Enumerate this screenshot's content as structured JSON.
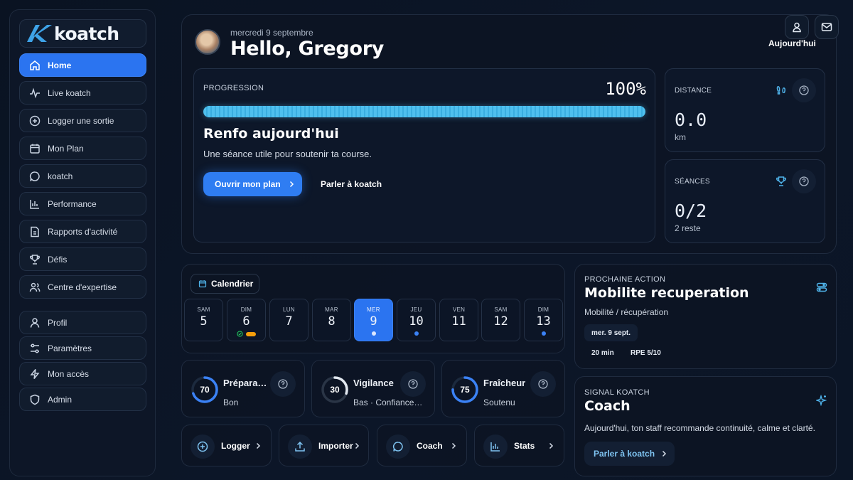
{
  "brand": {
    "name": "koatch"
  },
  "sidebar": {
    "items": [
      {
        "label": "Home",
        "icon": "home-icon"
      },
      {
        "label": "Live koatch",
        "icon": "activity-icon"
      },
      {
        "label": "Logger une sortie",
        "icon": "plus-circle-icon"
      },
      {
        "label": "Mon Plan",
        "icon": "calendar-icon"
      },
      {
        "label": "koatch",
        "icon": "chat-icon"
      },
      {
        "label": "Performance",
        "icon": "bar-chart-icon"
      },
      {
        "label": "Rapports d'activité",
        "icon": "document-icon"
      },
      {
        "label": "Défis",
        "icon": "trophy-icon"
      },
      {
        "label": "Centre d'expertise",
        "icon": "users-icon"
      }
    ],
    "bottom_items": [
      {
        "label": "Profil",
        "icon": "user-icon"
      },
      {
        "label": "Paramètres",
        "icon": "sliders-icon"
      },
      {
        "label": "Mon accès",
        "icon": "bolt-icon"
      },
      {
        "label": "Admin",
        "icon": "shield-icon"
      }
    ]
  },
  "header": {
    "date": "mercredi 9 septembre",
    "greeting": "Hello, Gregory",
    "today_label": "Aujourd'hui"
  },
  "progression": {
    "label": "PROGRESSION",
    "percent_text": "100%",
    "percent": 100,
    "title": "Renfo aujourd'hui",
    "subtitle": "Une séance utile pour soutenir ta course.",
    "primary_button": "Ouvrir mon plan",
    "secondary_button": "Parler à koatch"
  },
  "stats": {
    "distance": {
      "label": "DISTANCE",
      "value": "0.0",
      "unit": "km"
    },
    "sessions": {
      "label": "SÉANCES",
      "value": "0/2",
      "sub": "2 reste"
    }
  },
  "calendar": {
    "button": "Calendrier",
    "days": [
      {
        "name": "SAM",
        "num": "5"
      },
      {
        "name": "DIM",
        "num": "6"
      },
      {
        "name": "LUN",
        "num": "7"
      },
      {
        "name": "MAR",
        "num": "8"
      },
      {
        "name": "MER",
        "num": "9"
      },
      {
        "name": "JEU",
        "num": "10"
      },
      {
        "name": "VEN",
        "num": "11"
      },
      {
        "name": "SAM",
        "num": "12"
      },
      {
        "name": "DIM",
        "num": "13"
      }
    ]
  },
  "metrics": [
    {
      "title": "Préparation",
      "value": "70",
      "status": "Bon",
      "level": 0.7
    },
    {
      "title": "Vigilance",
      "value": "30",
      "status": "Bas · Confiance moyenne",
      "level": 0.3
    },
    {
      "title": "Fraîcheur",
      "value": "75",
      "status": "Soutenu",
      "level": 0.75
    }
  ],
  "quick_actions": [
    {
      "label": "Logger",
      "icon": "plus-circle-icon"
    },
    {
      "label": "Importer",
      "icon": "upload-icon"
    },
    {
      "label": "Coach",
      "icon": "chat-icon"
    },
    {
      "label": "Stats",
      "icon": "bar-chart-icon"
    }
  ],
  "next_action": {
    "label": "PROCHAINE ACTION",
    "title": "Mobilite recuperation",
    "category": "Mobilité / récupération",
    "date_chip": "mer. 9 sept.",
    "duration": "20 min",
    "rpe": "RPE 5/10"
  },
  "signal": {
    "label": "SIGNAL KOATCH",
    "title": "Coach",
    "message": "Aujourd'hui, ton staff recommande continuité, calme et clarté.",
    "button": "Parler à koatch"
  },
  "colors": {
    "accent": "#2f7df2",
    "cyan": "#4fc0ee",
    "background": "#0b1424"
  }
}
